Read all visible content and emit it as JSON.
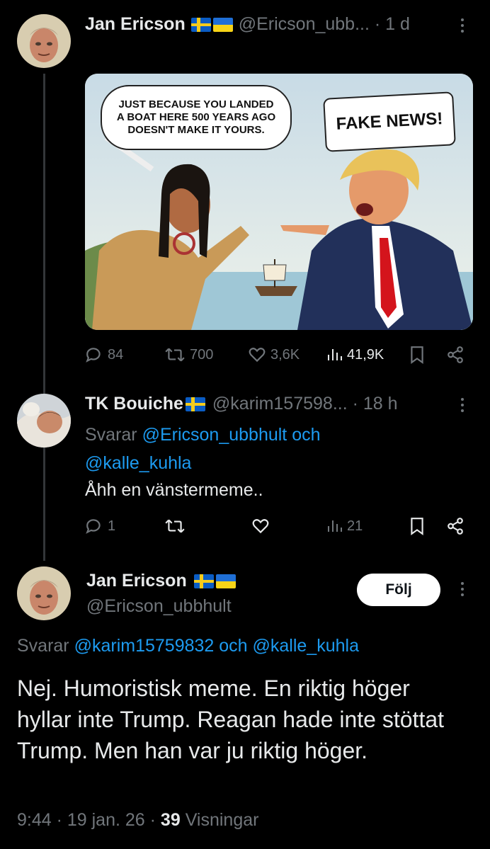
{
  "tweet1": {
    "author_name": "Jan Ericson",
    "handle_time": "@Ericson_ubb... · 1 d",
    "image": {
      "speech_left": "Just because you landed a boat here 500 years ago doesn't make it yours.",
      "speech_right": "Fake news!"
    },
    "stats": {
      "replies": "84",
      "retweets": "700",
      "likes": "3,6K",
      "views": "41,9K"
    }
  },
  "tweet2": {
    "author_name": "TK Bouiche",
    "handle_time": "@karim157598... · 18 h",
    "replying_prefix": "Svarar",
    "replying_to_1": "@Ericson_ubbhult och",
    "replying_to_2": "@kalle_kuhla",
    "text": "Åhh en vänstermeme..",
    "stats": {
      "replies": "1",
      "views": "21"
    }
  },
  "tweet3": {
    "author_name": "Jan Ericson",
    "handle": "@Ericson_ubbhult",
    "follow_label": "Följ",
    "replying_prefix": "Svarar",
    "replying_to": "@karim15759832 och @kalle_kuhla",
    "text": "Nej. Humoristisk meme. En riktig höger hyllar inte Trump. Reagan hade inte stöttat Trump. Men han var ju riktig höger.",
    "timestamp": "9:44 · 19 jan. 26 ·",
    "view_count": "39",
    "views_label": "Visningar"
  },
  "colors": {
    "background": "#000000",
    "text": "#e7e9ea",
    "muted": "#71767b",
    "link": "#1d9bf0",
    "thread_line": "#333639"
  },
  "icons": [
    "reply-icon",
    "retweet-icon",
    "like-icon",
    "views-icon",
    "bookmark-icon",
    "share-icon",
    "more-icon"
  ]
}
